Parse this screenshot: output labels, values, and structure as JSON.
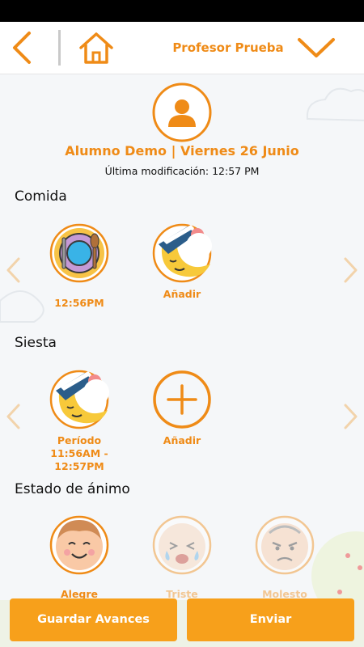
{
  "header": {
    "title": "Profesor Prueba",
    "back_icon": "chevron-left-icon",
    "home_icon": "home-icon",
    "menu_icon": "chevron-down-icon",
    "accent_color": "#ef8b17"
  },
  "student": {
    "name": "Alumno Demo",
    "date": "| Viernes 26 Junio",
    "last_modified": "Última modificación: 12:57 PM"
  },
  "sections": {
    "comida": {
      "title": "Comida",
      "items": [
        {
          "icon": "plate-fork-icon",
          "label": "12:56PM"
        },
        {
          "icon": "sleeping-moon-icon",
          "label": "Añadir"
        }
      ]
    },
    "siesta": {
      "title": "Siesta",
      "items": [
        {
          "icon": "sleeping-moon-icon",
          "label": "Período",
          "sub": "11:56AM - 12:57PM"
        },
        {
          "icon": "plus-circle-icon",
          "label": "Añadir"
        }
      ]
    },
    "animo": {
      "title": "Estado de ánimo",
      "items": [
        {
          "icon": "happy-baby-icon",
          "label": "Alegre"
        },
        {
          "icon": "crying-baby-icon",
          "label": "Triste"
        },
        {
          "icon": "angry-baby-icon",
          "label": "Molesto"
        }
      ]
    }
  },
  "buttons": {
    "save": "Guardar Avances",
    "send": "Enviar",
    "color": "#f7a01b"
  }
}
